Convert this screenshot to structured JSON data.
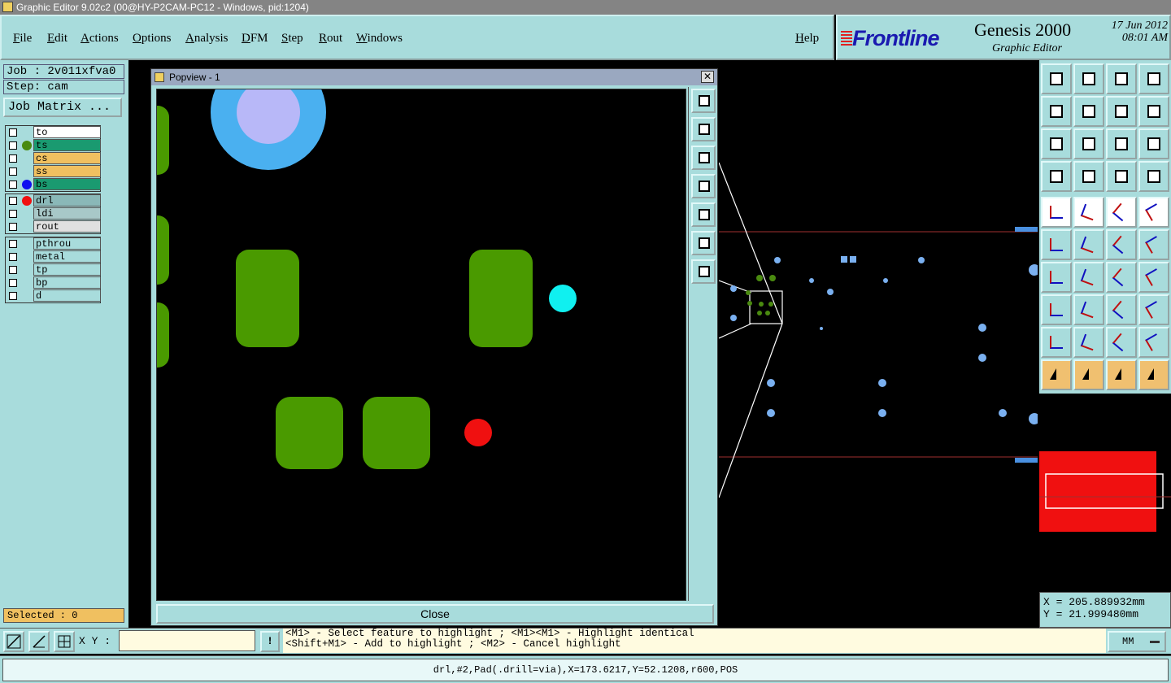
{
  "window": {
    "title": "Graphic Editor 9.02c2 (00@HY-P2CAM-PC12 - Windows, pid:1204)"
  },
  "menu": {
    "items": [
      "File",
      "Edit",
      "Actions",
      "Options",
      "Analysis",
      "DFM",
      "Step",
      "Rout",
      "Windows"
    ],
    "help": "Help"
  },
  "brand": {
    "logo": "Frontline",
    "product": "Genesis 2000",
    "subtitle": "Graphic Editor",
    "date": "17 Jun 2012",
    "time": "08:01 AM"
  },
  "left": {
    "job": "Job : 2v011xfva0",
    "step": "Step: cam",
    "job_matrix": "Job Matrix ...",
    "layers_board": [
      {
        "name": "to",
        "bg": "#ffffff",
        "dot": ""
      },
      {
        "name": "ts",
        "bg": "#1a9a70",
        "dot": "#4a8a10"
      },
      {
        "name": "cs",
        "bg": "#f0c060",
        "dot": ""
      },
      {
        "name": "ss",
        "bg": "#f0c060",
        "dot": ""
      },
      {
        "name": "bs",
        "bg": "#1a9a70",
        "dot": "#1010f0"
      }
    ],
    "layers_drill": [
      {
        "name": "drl",
        "bg": "#8ab8b8",
        "dot": "#f01010"
      },
      {
        "name": "ldi",
        "bg": "#a8c8c8",
        "dot": ""
      },
      {
        "name": "rout",
        "bg": "#e0e0e0",
        "dot": ""
      }
    ],
    "layers_misc": [
      {
        "name": "pthrou",
        "bg": "#a8dcdc",
        "dot": ""
      },
      {
        "name": "metal",
        "bg": "#a8dcdc",
        "dot": ""
      },
      {
        "name": "tp",
        "bg": "#a8dcdc",
        "dot": ""
      },
      {
        "name": "bp",
        "bg": "#a8dcdc",
        "dot": ""
      },
      {
        "name": "d",
        "bg": "#a8dcdc",
        "dot": ""
      }
    ],
    "selected": "Selected : 0"
  },
  "popview": {
    "title": "Popview - 1",
    "close_label": "Close",
    "side_buttons": [
      "zoom-home-icon",
      "zoom-up-icon",
      "zoom-down-icon",
      "pan-left-icon",
      "pan-right-icon",
      "zoom-fit-icon",
      "pan-center-icon"
    ]
  },
  "coords": {
    "x": "X = 205.889932mm",
    "y": "Y = 21.999480mm"
  },
  "bottom": {
    "xy_label": "X Y :",
    "xy_value": "",
    "hint1": "<M1> - Select feature to highlight ; <M1><M1> - Highlight identical",
    "hint2": "<Shift+M1> - Add to highlight ; <M2> - Cancel highlight",
    "units": "MM"
  },
  "status": {
    "text": "drl,#2,Pad(.drill=via),X=173.6217,Y=52.1208,r600,POS"
  },
  "toolbar": {
    "icons": [
      "open-icon",
      "save-icon",
      "home-icon",
      "window-icon",
      "back-icon",
      "forward-icon",
      "undo-icon",
      "redo-icon",
      "zoom-fit-icon",
      "zoom-center-icon",
      "scale-1-2-icon",
      "help-icon",
      "profile-icon",
      "grid-icon",
      "snap-icon",
      "snap-active-icon",
      "select-pad-icon",
      "edit-shape-icon",
      "ruler-icon",
      "fill-icon",
      "connect-icon",
      "cross-icon",
      "line-add-icon",
      "line-point-icon",
      "angle-icon",
      "diagonal-icon",
      "arc-icon",
      "break-icon",
      "pad-add-icon",
      "line-red-icon",
      "measure-icon",
      "multi-pad-icon",
      "triangle-icon",
      "arch-icon",
      "arch-alt-icon",
      "arch-dim-icon",
      "pointer-icon",
      "pointer-box-icon",
      "pointer-alt-icon",
      "route-icon"
    ]
  }
}
